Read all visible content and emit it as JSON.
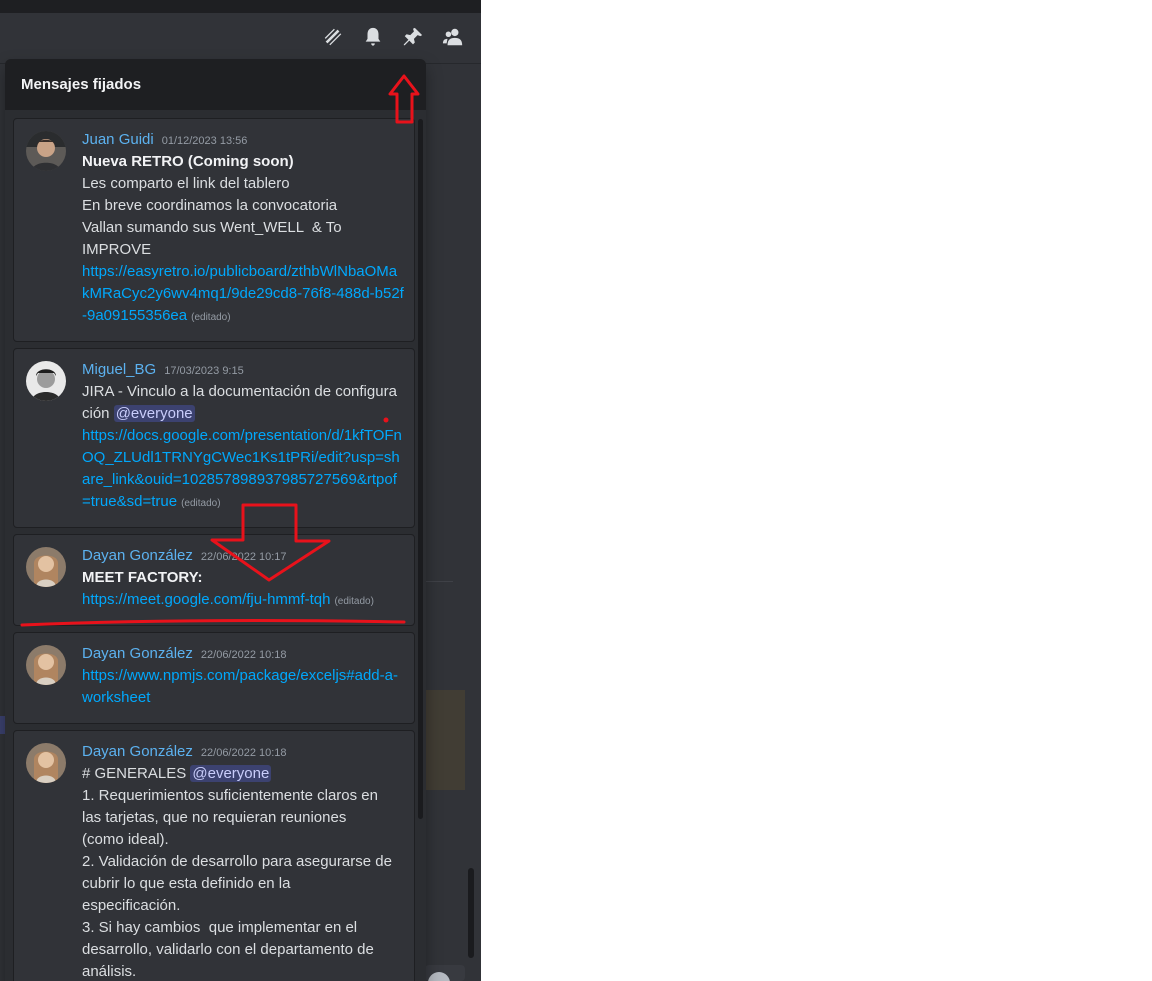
{
  "header": {
    "icons": [
      "threads-icon",
      "bell-icon",
      "pin-icon",
      "members-icon"
    ]
  },
  "pinned": {
    "title": "Mensajes fijados",
    "messages": [
      {
        "author": "Juan Guidi",
        "timestamp": "01/12/2023 13:56",
        "title": "Nueva RETRO (Coming soon)",
        "lines": [
          "Les comparto el link del tablero",
          "En breve coordinamos la convocatoria",
          "Vallan sumando sus Went_WELL  & To",
          "IMPROVE"
        ],
        "link": "https://easyretro.io/publicboard/zthbWlNbaOMakMRaCyc2y6wv4mq1/9de29cd8-76f8-488d-b52f-9a09155356ea",
        "edited": "(editado)"
      },
      {
        "author": "Miguel_BG",
        "timestamp": "17/03/2023 9:15",
        "text": "JIRA - Vinculo a la documentación de configuración",
        "mention": "@everyone",
        "link": "https://docs.google.com/presentation/d/1kfTOFnOQ_ZLUdl1TRNYgCWec1Ks1tPRi/edit?usp=share_link&ouid=102857898937985727569&rtpof=true&sd=true",
        "edited": "(editado)"
      },
      {
        "author": "Dayan González",
        "timestamp": "22/06/2022 10:17",
        "title": "MEET FACTORY:",
        "link": "https://meet.google.com/fju-hmmf-tqh",
        "edited": "(editado)"
      },
      {
        "author": "Dayan González",
        "timestamp": "22/06/2022 10:18",
        "link": "https://www.npmjs.com/package/exceljs#add-a-worksheet"
      },
      {
        "author": "Dayan González",
        "timestamp": "22/06/2022 10:18",
        "heading": "# GENERALES",
        "mention": "@everyone",
        "lines": [
          "1. Requerimientos suficientemente claros en",
          "las tarjetas, que no requieran reuniones",
          "(como ideal).",
          "2. Validación de desarrollo para asegurarse de",
          "cubrir lo que esta definido en la",
          "especificación.",
          "3. Si hay cambios  que implementar en el",
          "desarrollo, validarlo con el departamento de",
          "análisis."
        ]
      }
    ]
  },
  "colors": {
    "annotation": "#e8121b",
    "link": "#00a8fc",
    "author": "#5cb2f0"
  }
}
